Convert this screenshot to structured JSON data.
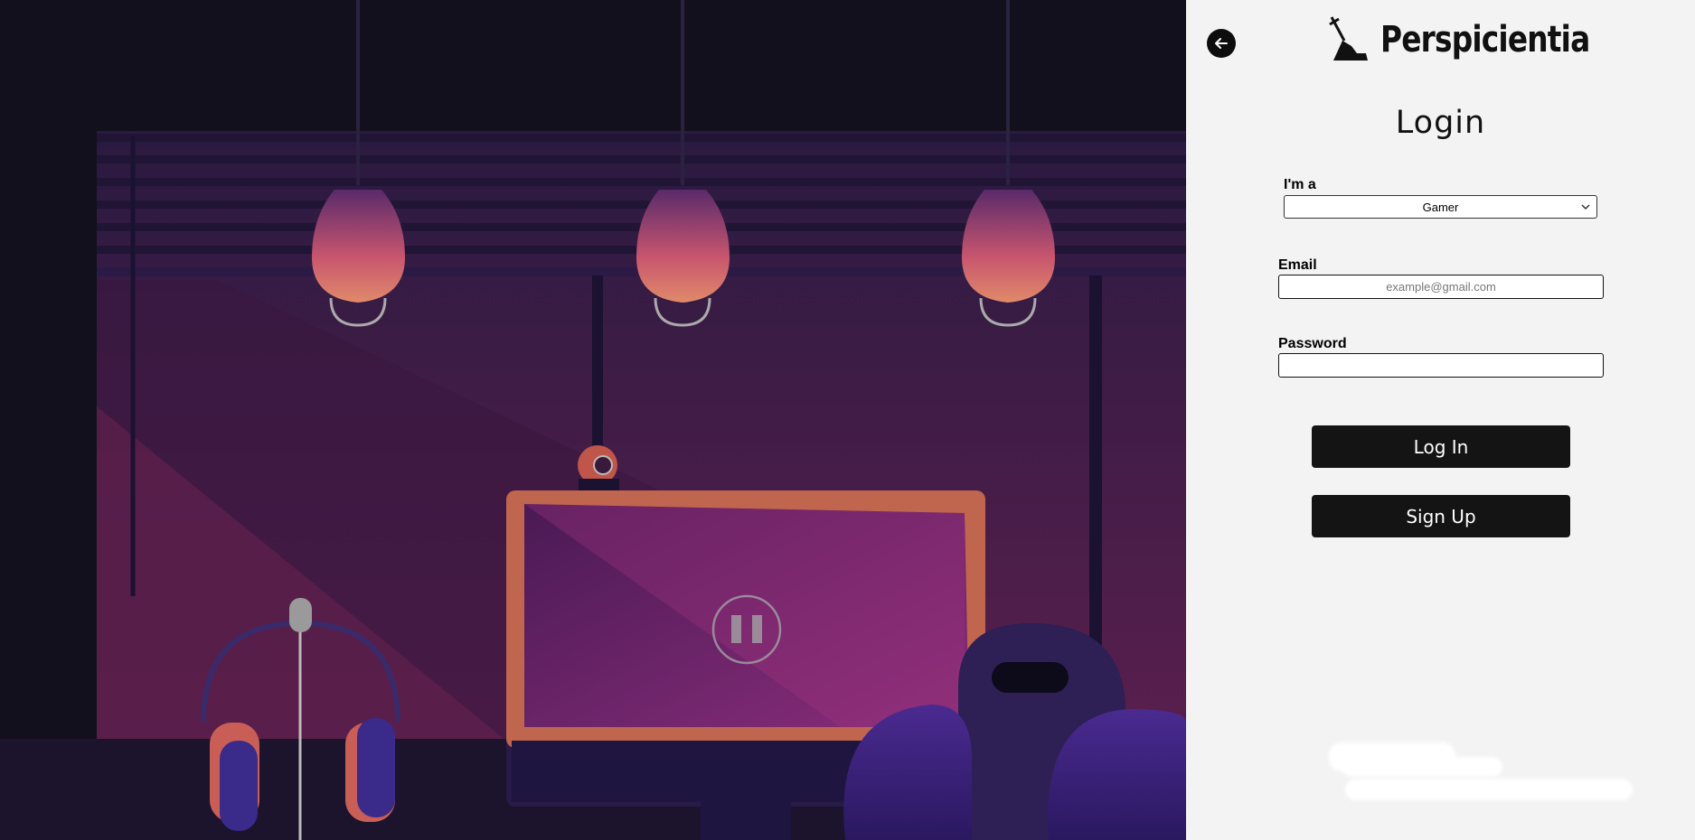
{
  "scene": {
    "playback_state": "paused",
    "icons": [
      "pause-icon"
    ]
  },
  "panel": {
    "back_icon": "arrow-left-icon",
    "logo_icon": "sword-in-stone-icon",
    "brand": "Perspicientia",
    "title": "Login",
    "role": {
      "label": "I'm a",
      "selected": "Gamer"
    },
    "email": {
      "label": "Email",
      "placeholder": "example@gmail.com",
      "value": ""
    },
    "password": {
      "label": "Password",
      "value": ""
    },
    "login_label": "Log In",
    "signup_label": "Sign Up"
  },
  "colors": {
    "panel_bg": "#f3f3f3",
    "button_bg": "#141414",
    "scene_bg": "#13101e",
    "accent_magenta": "#7a2a78",
    "lamp_glow": "#d97070"
  }
}
